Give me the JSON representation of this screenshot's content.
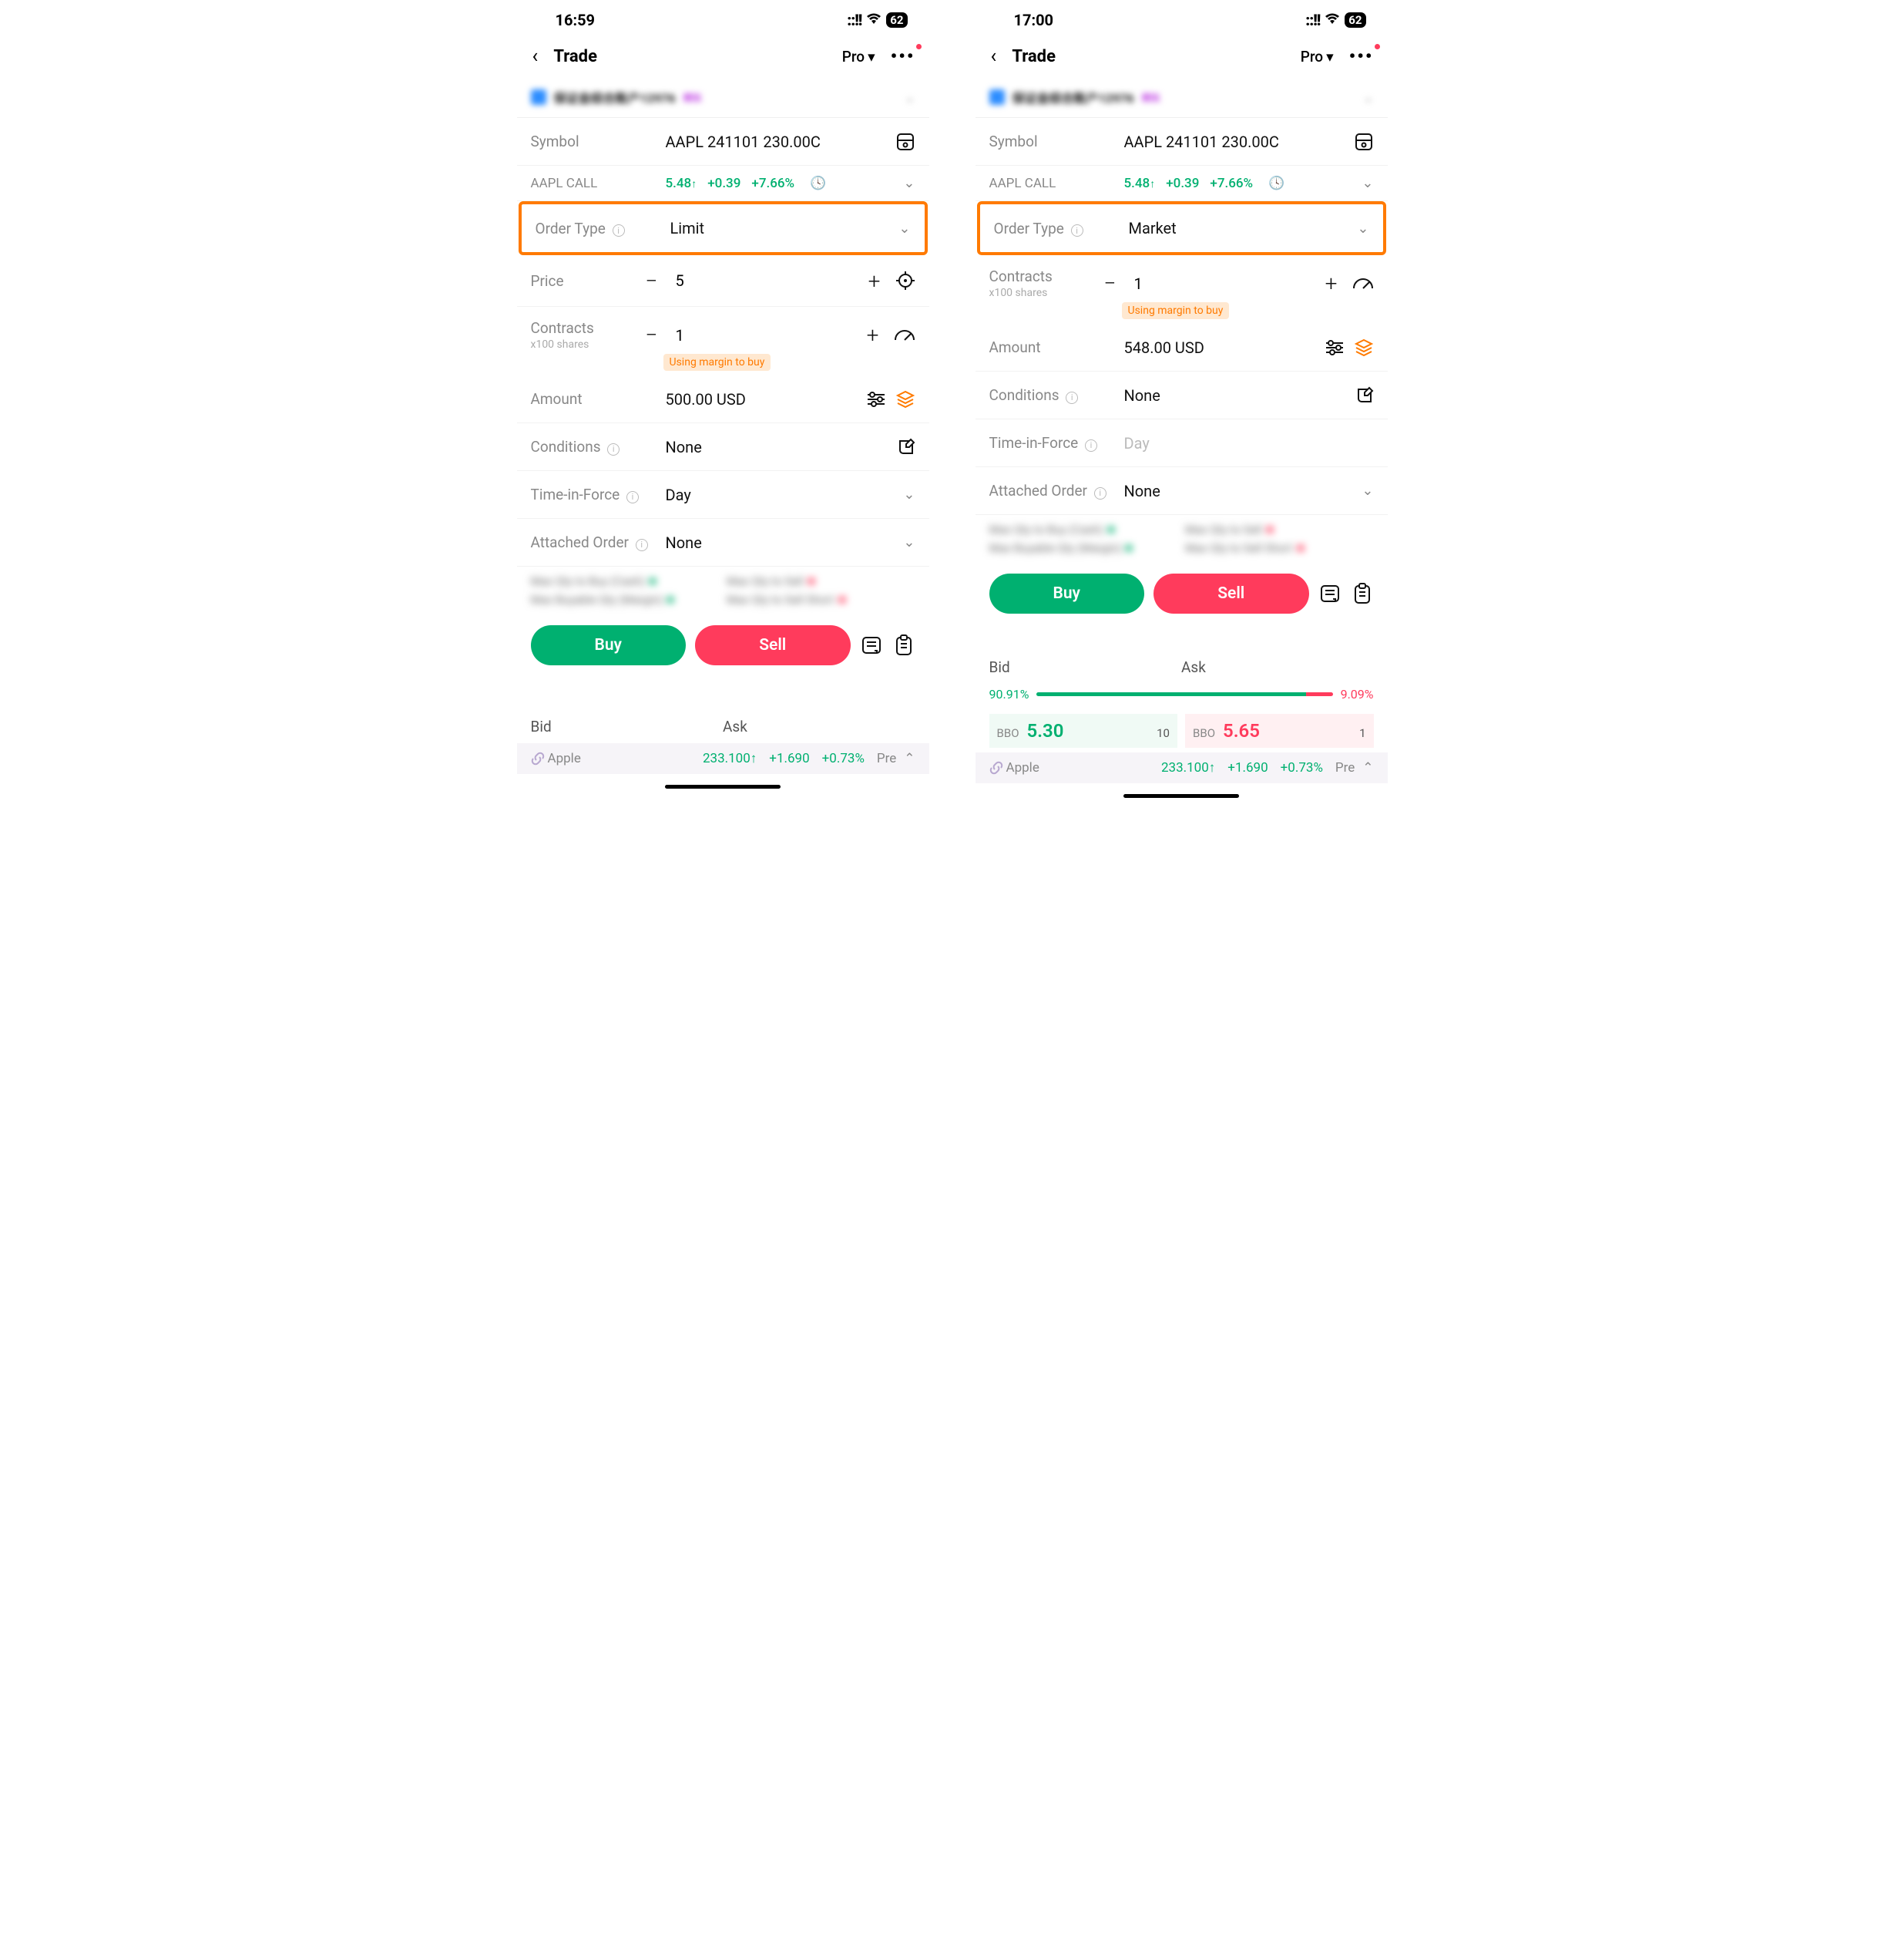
{
  "left": {
    "time": "16:59",
    "battery": "62",
    "title": "Trade",
    "mode": "Pro",
    "account_text": "保证金综合账户12976",
    "account_badge": "模拟",
    "symbol_label": "Symbol",
    "symbol_value": "AAPL 241101 230.00C",
    "quote_label": "AAPL CALL",
    "quote_price": "5.48",
    "quote_change": "+0.39",
    "quote_pct": "+7.66%",
    "ordertype_label": "Order Type",
    "ordertype_value": "Limit",
    "price_label": "Price",
    "price_value": "5",
    "contracts_label": "Contracts",
    "contracts_sub": "x100 shares",
    "contracts_value": "1",
    "margin_note": "Using margin to buy",
    "amount_label": "Amount",
    "amount_value": "500.00 USD",
    "conditions_label": "Conditions",
    "conditions_value": "None",
    "tif_label": "Time-in-Force",
    "tif_value": "Day",
    "attached_label": "Attached Order",
    "attached_value": "None",
    "blur_items": [
      "Max Qty to Buy (Cash)",
      "Max Qty to Sell",
      "Max Buyable Qty (Margin)",
      "Max Qty to Sell Short"
    ],
    "buy_label": "Buy",
    "sell_label": "Sell",
    "bid_label": "Bid",
    "ask_label": "Ask",
    "ticker_name": "Apple",
    "ticker_price": "233.100",
    "ticker_change": "+1.690",
    "ticker_pct": "+0.73%",
    "ticker_session": "Pre"
  },
  "right": {
    "time": "17:00",
    "battery": "62",
    "title": "Trade",
    "mode": "Pro",
    "account_text": "保证金综合账户12976",
    "account_badge": "模拟",
    "symbol_label": "Symbol",
    "symbol_value": "AAPL 241101 230.00C",
    "quote_label": "AAPL CALL",
    "quote_price": "5.48",
    "quote_change": "+0.39",
    "quote_pct": "+7.66%",
    "ordertype_label": "Order Type",
    "ordertype_value": "Market",
    "contracts_label": "Contracts",
    "contracts_sub": "x100 shares",
    "contracts_value": "1",
    "margin_note": "Using margin to buy",
    "amount_label": "Amount",
    "amount_value": "548.00 USD",
    "conditions_label": "Conditions",
    "conditions_value": "None",
    "tif_label": "Time-in-Force",
    "tif_value": "Day",
    "attached_label": "Attached Order",
    "attached_value": "None",
    "blur_items": [
      "Max Qty to Buy (Cash)",
      "Max Qty to Sell",
      "Max Buyable Qty (Margin)",
      "Max Qty to Sell Short"
    ],
    "buy_label": "Buy",
    "sell_label": "Sell",
    "bid_label": "Bid",
    "ask_label": "Ask",
    "bid_pct": "90.91%",
    "ask_pct": "9.09%",
    "bbo_label": "BBO",
    "bbo_bid": "5.30",
    "bbo_bid_qty": "10",
    "bbo_ask": "5.65",
    "bbo_ask_qty": "1",
    "ticker_name": "Apple",
    "ticker_price": "233.100",
    "ticker_change": "+1.690",
    "ticker_pct": "+0.73%",
    "ticker_session": "Pre"
  }
}
